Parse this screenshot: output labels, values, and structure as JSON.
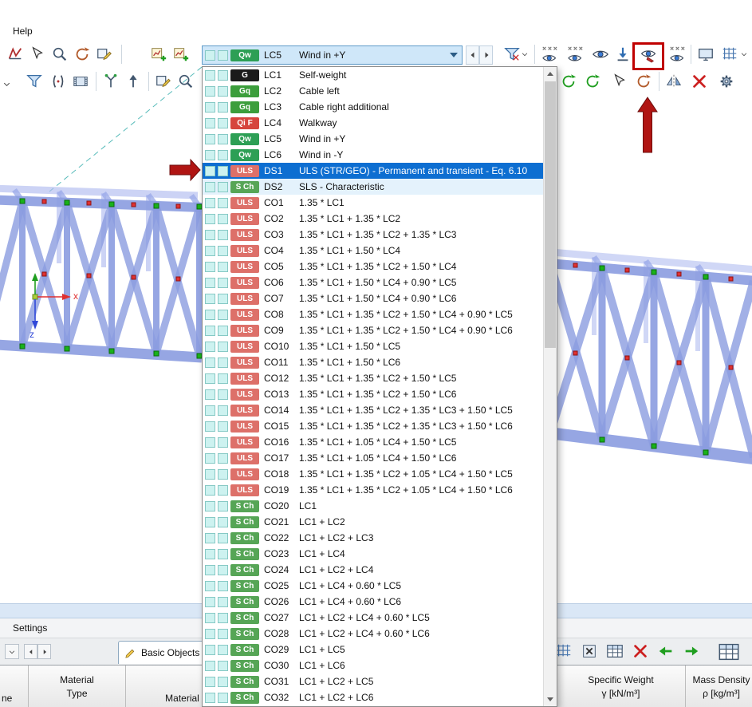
{
  "menu": {
    "help_label": "Help"
  },
  "toolbar": {
    "combobox": {
      "badge": "Qw",
      "id": "LC5",
      "label": "Wind in +Y"
    }
  },
  "badge_colors": {
    "g": {
      "bg": "#1b1b1b",
      "fg": "#ffffff"
    },
    "gq": {
      "bg": "#3c9e3c",
      "fg": "#ffffff"
    },
    "qif": {
      "bg": "#d6453d",
      "fg": "#ffffff"
    },
    "qw": {
      "bg": "#2d9f55",
      "fg": "#ffffff"
    },
    "uls": {
      "bg": "#dd7069",
      "fg": "#ffffff"
    },
    "sch": {
      "bg": "#56a556",
      "fg": "#ffffff"
    }
  },
  "dropdown": {
    "selected_id": "DS1",
    "highlighted_id": "DS2",
    "items": [
      {
        "badge": "G",
        "id": "LC1",
        "label": "Self-weight"
      },
      {
        "badge": "Gq",
        "id": "LC2",
        "label": "Cable left"
      },
      {
        "badge": "Gq",
        "id": "LC3",
        "label": "Cable right additional"
      },
      {
        "badge": "Qi F",
        "id": "LC4",
        "label": "Walkway"
      },
      {
        "badge": "Qw",
        "id": "LC5",
        "label": "Wind in +Y"
      },
      {
        "badge": "Qw",
        "id": "LC6",
        "label": "Wind in -Y"
      },
      {
        "badge": "ULS",
        "id": "DS1",
        "label": "ULS (STR/GEO) - Permanent and transient - Eq. 6.10"
      },
      {
        "badge": "S Ch",
        "id": "DS2",
        "label": "SLS - Characteristic"
      },
      {
        "badge": "ULS",
        "id": "CO1",
        "label": "1.35 * LC1"
      },
      {
        "badge": "ULS",
        "id": "CO2",
        "label": "1.35 * LC1 + 1.35 * LC2"
      },
      {
        "badge": "ULS",
        "id": "CO3",
        "label": "1.35 * LC1 + 1.35 * LC2 + 1.35 * LC3"
      },
      {
        "badge": "ULS",
        "id": "CO4",
        "label": "1.35 * LC1 + 1.50 * LC4"
      },
      {
        "badge": "ULS",
        "id": "CO5",
        "label": "1.35 * LC1 + 1.35 * LC2 + 1.50 * LC4"
      },
      {
        "badge": "ULS",
        "id": "CO6",
        "label": "1.35 * LC1 + 1.50 * LC4 + 0.90 * LC5"
      },
      {
        "badge": "ULS",
        "id": "CO7",
        "label": "1.35 * LC1 + 1.50 * LC4 + 0.90 * LC6"
      },
      {
        "badge": "ULS",
        "id": "CO8",
        "label": "1.35 * LC1 + 1.35 * LC2 + 1.50 * LC4 + 0.90 * LC5"
      },
      {
        "badge": "ULS",
        "id": "CO9",
        "label": "1.35 * LC1 + 1.35 * LC2 + 1.50 * LC4 + 0.90 * LC6"
      },
      {
        "badge": "ULS",
        "id": "CO10",
        "label": "1.35 * LC1 + 1.50 * LC5"
      },
      {
        "badge": "ULS",
        "id": "CO11",
        "label": "1.35 * LC1 + 1.50 * LC6"
      },
      {
        "badge": "ULS",
        "id": "CO12",
        "label": "1.35 * LC1 + 1.35 * LC2 + 1.50 * LC5"
      },
      {
        "badge": "ULS",
        "id": "CO13",
        "label": "1.35 * LC1 + 1.35 * LC2 + 1.50 * LC6"
      },
      {
        "badge": "ULS",
        "id": "CO14",
        "label": "1.35 * LC1 + 1.35 * LC2 + 1.35 * LC3 + 1.50 * LC5"
      },
      {
        "badge": "ULS",
        "id": "CO15",
        "label": "1.35 * LC1 + 1.35 * LC2 + 1.35 * LC3 + 1.50 * LC6"
      },
      {
        "badge": "ULS",
        "id": "CO16",
        "label": "1.35 * LC1 + 1.05 * LC4 + 1.50 * LC5"
      },
      {
        "badge": "ULS",
        "id": "CO17",
        "label": "1.35 * LC1 + 1.05 * LC4 + 1.50 * LC6"
      },
      {
        "badge": "ULS",
        "id": "CO18",
        "label": "1.35 * LC1 + 1.35 * LC2 + 1.05 * LC4 + 1.50 * LC5"
      },
      {
        "badge": "ULS",
        "id": "CO19",
        "label": "1.35 * LC1 + 1.35 * LC2 + 1.05 * LC4 + 1.50 * LC6"
      },
      {
        "badge": "S Ch",
        "id": "CO20",
        "label": "LC1"
      },
      {
        "badge": "S Ch",
        "id": "CO21",
        "label": "LC1 + LC2"
      },
      {
        "badge": "S Ch",
        "id": "CO22",
        "label": "LC1 + LC2 + LC3"
      },
      {
        "badge": "S Ch",
        "id": "CO23",
        "label": "LC1 + LC4"
      },
      {
        "badge": "S Ch",
        "id": "CO24",
        "label": "LC1 + LC2 + LC4"
      },
      {
        "badge": "S Ch",
        "id": "CO25",
        "label": "LC1 + LC4 + 0.60 * LC5"
      },
      {
        "badge": "S Ch",
        "id": "CO26",
        "label": "LC1 + LC4 + 0.60 * LC6"
      },
      {
        "badge": "S Ch",
        "id": "CO27",
        "label": "LC1 + LC2 + LC4 + 0.60 * LC5"
      },
      {
        "badge": "S Ch",
        "id": "CO28",
        "label": "LC1 + LC2 + LC4 + 0.60 * LC6"
      },
      {
        "badge": "S Ch",
        "id": "CO29",
        "label": "LC1 + LC5"
      },
      {
        "badge": "S Ch",
        "id": "CO30",
        "label": "LC1 + LC6"
      },
      {
        "badge": "S Ch",
        "id": "CO31",
        "label": "LC1 + LC2 + LC5"
      },
      {
        "badge": "S Ch",
        "id": "CO32",
        "label": "LC1 + LC2 + LC6"
      }
    ]
  },
  "viewport": {
    "axis_x_label": "x",
    "axis_z_label": "z"
  },
  "bottom_panel": {
    "settings_label": "Settings",
    "tab_label": "Basic Objects",
    "table": {
      "name_header_partial": "ne",
      "col_material_type_line1": "Material",
      "col_material_type_line2": "Type",
      "col_material": "Material",
      "col_specific_weight_line1": "Specific Weight",
      "col_specific_weight_line2": "γ [kN/m³]",
      "col_mass_density_line1": "Mass Density",
      "col_mass_density_line2": "ρ [kg/m³]"
    }
  },
  "colors": {
    "selection_bg": "#0d6ed1",
    "selection_fg": "#ffffff",
    "annotation_red": "#b01513",
    "highlight_red": "#c00000"
  }
}
